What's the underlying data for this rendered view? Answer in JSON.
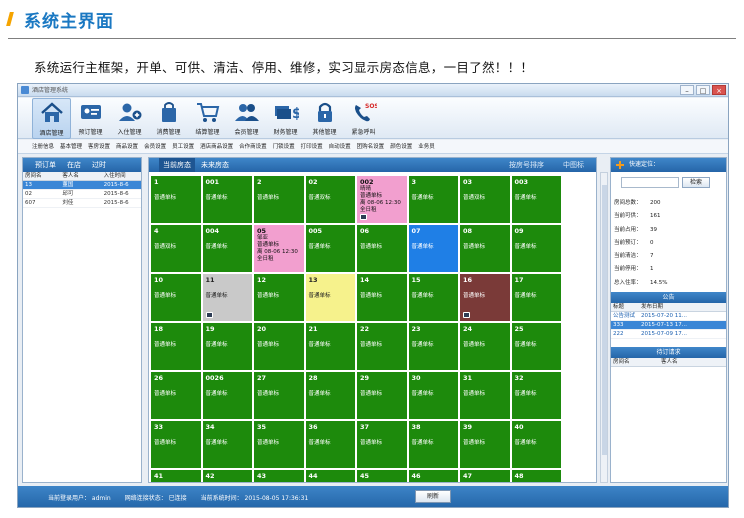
{
  "heading": {
    "title": "系统主界面"
  },
  "intro": "系统运行主框架，开单、可供、清洁、停用、维修，实习显示房态信息，一目了然！！！",
  "window": {
    "title": "酒店管理系统",
    "controls": {
      "minimize": "–",
      "maximize": "□",
      "close": "×"
    }
  },
  "toolbar": [
    {
      "label": "酒店管理",
      "icon": "home-icon"
    },
    {
      "label": "预订管理",
      "icon": "id-card-icon"
    },
    {
      "label": "入住管理",
      "icon": "add-user-icon"
    },
    {
      "label": "消费管理",
      "icon": "shopping-bag-icon"
    },
    {
      "label": "结算管理",
      "icon": "cart-icon"
    },
    {
      "label": "会员管理",
      "icon": "members-icon"
    },
    {
      "label": "财务管理",
      "icon": "money-icon"
    },
    {
      "label": "其他管理",
      "icon": "lock-icon"
    },
    {
      "label": "紧急呼叫",
      "icon": "sos-phone-icon"
    }
  ],
  "menu": [
    "注册信息",
    "基本管理",
    "客房设置",
    "商品设置",
    "会员设置",
    "员工设置",
    "酒店商品设置",
    "合作商设置",
    "门锁设置",
    "打印设置",
    "自动设置",
    "团购名设置",
    "颜色设置",
    "业务员"
  ],
  "left_panel": {
    "tabs": [
      "预订单",
      "在店",
      "过时"
    ],
    "columns": [
      "房间名",
      "客人名",
      "入住时间"
    ],
    "rows": [
      {
        "room": "13",
        "guest": "董国",
        "time": "2015-8-6"
      },
      {
        "room": "02",
        "guest": "邱可",
        "time": "2015-8-6"
      },
      {
        "room": "607",
        "guest": "刘佳",
        "time": "2015-8-6"
      }
    ]
  },
  "board": {
    "tabs": [
      "当前房态",
      "未来房态"
    ],
    "sort_label": "按房号排序",
    "view_label": "中图标",
    "rooms": [
      {
        "no": "1",
        "type": "普通单标",
        "status": "green"
      },
      {
        "no": "001",
        "type": "普通单标",
        "status": "green"
      },
      {
        "no": "2",
        "type": "普通单标",
        "status": "green"
      },
      {
        "no": "02",
        "type": "普通双标",
        "status": "green"
      },
      {
        "no": "002",
        "guest": "晴晴",
        "type": "普通单标",
        "time": "离 08-06 12:30",
        "plan": "全日租",
        "status": "pink",
        "badge": true
      },
      {
        "no": "3",
        "type": "普通单标",
        "status": "green"
      },
      {
        "no": "03",
        "type": "普通双标",
        "status": "green"
      },
      {
        "no": "003",
        "type": "普通单标",
        "status": "green"
      },
      {
        "no": "4",
        "type": "普通双标",
        "status": "green"
      },
      {
        "no": "004",
        "type": "普通单标",
        "status": "green"
      },
      {
        "no": "05",
        "guest": "邹亚",
        "type": "普通单标",
        "time": "离 08-06 12:30",
        "plan": "全日租",
        "status": "pink"
      },
      {
        "no": "005",
        "type": "普通单标",
        "status": "green"
      },
      {
        "no": "06",
        "type": "普通单标",
        "status": "green"
      },
      {
        "no": "07",
        "type": "普通单标",
        "status": "blue"
      },
      {
        "no": "08",
        "type": "普通单标",
        "status": "green"
      },
      {
        "no": "09",
        "type": "普通单标",
        "status": "green"
      },
      {
        "no": "10",
        "type": "普通单标",
        "status": "green"
      },
      {
        "no": "11",
        "type": "普通单标",
        "status": "gray",
        "badge": true
      },
      {
        "no": "12",
        "type": "普通单标",
        "status": "green"
      },
      {
        "no": "13",
        "type": "普通单标",
        "status": "yellow"
      },
      {
        "no": "14",
        "type": "普通单标",
        "status": "green"
      },
      {
        "no": "15",
        "type": "普通单标",
        "status": "green"
      },
      {
        "no": "16",
        "type": "普通单标",
        "status": "brown",
        "badge": true
      },
      {
        "no": "17",
        "type": "普通单标",
        "status": "green"
      },
      {
        "no": "18",
        "type": "普通单标",
        "status": "green"
      },
      {
        "no": "19",
        "type": "普通单标",
        "status": "green"
      },
      {
        "no": "20",
        "type": "普通单标",
        "status": "green"
      },
      {
        "no": "21",
        "type": "普通单标",
        "status": "green"
      },
      {
        "no": "22",
        "type": "普通单标",
        "status": "green"
      },
      {
        "no": "23",
        "type": "普通单标",
        "status": "green"
      },
      {
        "no": "24",
        "type": "普通单标",
        "status": "green"
      },
      {
        "no": "25",
        "type": "普通单标",
        "status": "green"
      },
      {
        "no": "26",
        "type": "普通单标",
        "status": "green"
      },
      {
        "no": "0026",
        "type": "普通单标",
        "status": "green"
      },
      {
        "no": "27",
        "type": "普通单标",
        "status": "green"
      },
      {
        "no": "28",
        "type": "普通单标",
        "status": "green"
      },
      {
        "no": "29",
        "type": "普通单标",
        "status": "green"
      },
      {
        "no": "30",
        "type": "普通单标",
        "status": "green"
      },
      {
        "no": "31",
        "type": "普通单标",
        "status": "green"
      },
      {
        "no": "32",
        "type": "普通单标",
        "status": "green"
      },
      {
        "no": "33",
        "type": "普通单标",
        "status": "green"
      },
      {
        "no": "34",
        "type": "普通单标",
        "status": "green"
      },
      {
        "no": "35",
        "type": "普通单标",
        "status": "green"
      },
      {
        "no": "36",
        "type": "普通单标",
        "status": "green"
      },
      {
        "no": "37",
        "type": "普通单标",
        "status": "green"
      },
      {
        "no": "38",
        "type": "普通单标",
        "status": "green"
      },
      {
        "no": "39",
        "type": "普通单标",
        "status": "green"
      },
      {
        "no": "40",
        "type": "普通单标",
        "status": "green"
      },
      {
        "no": "41",
        "type": "",
        "status": "green"
      },
      {
        "no": "42",
        "type": "",
        "status": "green"
      },
      {
        "no": "43",
        "type": "",
        "status": "green"
      },
      {
        "no": "44",
        "type": "",
        "status": "green"
      },
      {
        "no": "45",
        "type": "",
        "status": "green"
      },
      {
        "no": "46",
        "type": "",
        "status": "green"
      },
      {
        "no": "47",
        "type": "",
        "status": "green"
      },
      {
        "no": "48",
        "type": "",
        "status": "green"
      }
    ]
  },
  "right_panel": {
    "title": "快速定位：",
    "search_button": "检索",
    "stats": [
      {
        "label": "房间总数：",
        "value": "200"
      },
      {
        "label": "当前可供：",
        "value": "161"
      },
      {
        "label": "当前占用：",
        "value": "39"
      },
      {
        "label": "当前预订：",
        "value": "0"
      },
      {
        "label": "当前清洁：",
        "value": "7"
      },
      {
        "label": "当前停用：",
        "value": "1"
      },
      {
        "label": "总入住率：",
        "value": "14.5%"
      }
    ],
    "announcement": {
      "title": "公告",
      "columns": [
        "标题",
        "发布日期"
      ],
      "rows": [
        {
          "title": "公告测试",
          "date": "2015-07-20 11..."
        },
        {
          "title": "333",
          "date": "2015-07-13 17..."
        },
        {
          "title": "222",
          "date": "2015-07-09 17..."
        }
      ]
    },
    "pending": {
      "title": "待订请求",
      "columns": [
        "房间名",
        "客人名"
      ]
    }
  },
  "statusbar": {
    "user": "当前登录用户：  admin",
    "network": "网络连接状态：  已连接",
    "time": "当前系统时间：  2015-08-05 17:36:31",
    "refresh": "刷新"
  },
  "colors": {
    "accent_blue": "#2565a8",
    "room_available": "#1d8a0c",
    "room_occupied": "#f29fcf",
    "room_reserved": "#1f7fe6",
    "room_disabled": "#c9c9c9",
    "room_cleaning": "#f6f28c",
    "room_repair": "#7a3a38"
  }
}
